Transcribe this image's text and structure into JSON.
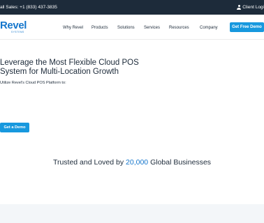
{
  "topbar": {
    "call_label": "all Sales: +1 (833) 437-3835",
    "login_label": "Client Logi"
  },
  "nav": {
    "logo_text": "Revel",
    "logo_sub": "SYSTEMS",
    "items": [
      "Why Revel",
      "Products",
      "Solutions",
      "Services",
      "Resources",
      "Company"
    ],
    "cta_label": "Get Free Demo"
  },
  "hero": {
    "headline_line1": "Leverage the Most Flexible Cloud POS",
    "headline_line2": "System for Multi-Location Growth",
    "subcopy": "Utilize Revel's Cloud POS Platform to:",
    "button_label": "Get a Demo"
  },
  "trusted": {
    "prefix": "Trusted and Loved by ",
    "number": "20,000",
    "suffix": " Global Businesses"
  },
  "colors": {
    "topbar_bg": "#1d2b3a",
    "accent": "#1798de",
    "brand": "#1476cc",
    "text": "#1d2b3a"
  }
}
